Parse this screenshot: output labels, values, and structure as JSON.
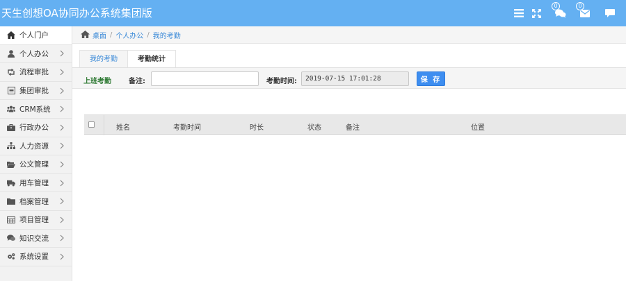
{
  "app": {
    "title": "天生创想OA协同办公系统集团版"
  },
  "topbar": {
    "icons": [
      {
        "name": "menu-icon"
      },
      {
        "name": "fullscreen-icon"
      },
      {
        "name": "chat-icon",
        "badge": "0"
      },
      {
        "name": "mail-icon",
        "badge": "0"
      },
      {
        "name": "message-icon"
      }
    ]
  },
  "sidebar": {
    "items": [
      {
        "label": "个人门户",
        "icon": "home-icon"
      },
      {
        "label": "个人办公",
        "icon": "user-icon"
      },
      {
        "label": "流程审批",
        "icon": "retweet-icon"
      },
      {
        "label": "集团审批",
        "icon": "list-icon"
      },
      {
        "label": "CRM系统",
        "icon": "users-icon"
      },
      {
        "label": "行政办公",
        "icon": "briefcase-icon"
      },
      {
        "label": "人力资源",
        "icon": "sitemap-icon"
      },
      {
        "label": "公文管理",
        "icon": "folder-open-icon"
      },
      {
        "label": "用车管理",
        "icon": "truck-icon"
      },
      {
        "label": "档案管理",
        "icon": "folder-icon"
      },
      {
        "label": "项目管理",
        "icon": "table-icon"
      },
      {
        "label": "知识交流",
        "icon": "comments-icon"
      },
      {
        "label": "系统设置",
        "icon": "cogs-icon"
      }
    ]
  },
  "breadcrumb": {
    "items": [
      "桌面",
      "个人办公",
      "我的考勤"
    ]
  },
  "tabs": [
    {
      "label": "我的考勤",
      "active": true
    },
    {
      "label": "考勤统计",
      "active": false
    }
  ],
  "form": {
    "type_label": "上班考勤",
    "note_label": "备注:",
    "note_value": "",
    "time_label": "考勤时间:",
    "time_value": "2019-07-15 17:01:28",
    "save_label": "保 存"
  },
  "table": {
    "headers": [
      "姓名",
      "考勤时间",
      "时长",
      "状态",
      "备注",
      "位置"
    ]
  },
  "colors": {
    "topbar": "#64b0f2",
    "accent": "#3e8ef0",
    "green": "#2f7a34"
  }
}
